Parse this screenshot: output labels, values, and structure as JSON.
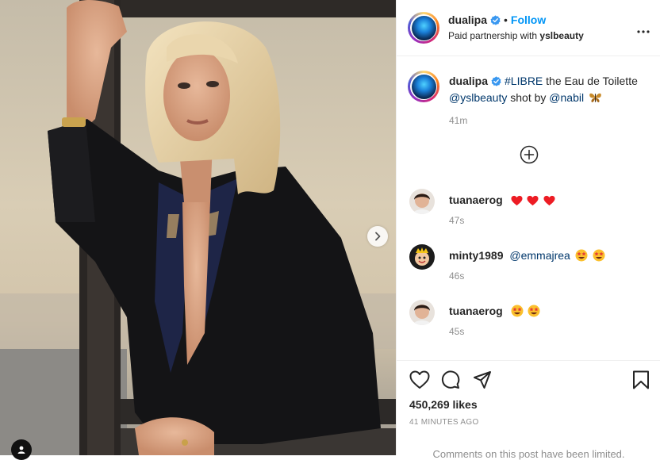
{
  "post": {
    "author": "dualipa",
    "follow_label": "Follow",
    "separator": "•",
    "partnership_prefix": "Paid partnership with",
    "partner": "yslbeauty"
  },
  "caption": {
    "user": "dualipa",
    "hashtag": "#LIBRE",
    "text1": "the Eau de Toilette",
    "mention1": "@yslbeauty",
    "text2": "shot by",
    "mention2": "@nabil",
    "emoji": "butterfly-icon",
    "time": "41m"
  },
  "comments": [
    {
      "user": "tuanaerog",
      "text": "",
      "emojis": [
        "heart-icon",
        "heart-icon",
        "heart-icon"
      ],
      "time": "47s"
    },
    {
      "user": "minty1989",
      "mention": "@emmajrea",
      "emojis": [
        "star-eyes-icon",
        "star-eyes-icon"
      ],
      "time": "46s"
    },
    {
      "user": "tuanaerog",
      "text": "",
      "emojis": [
        "star-eyes-icon",
        "star-eyes-icon"
      ],
      "time": "45s"
    }
  ],
  "actions": {
    "likes": "450,269 likes",
    "time_ago": "41 MINUTES AGO",
    "limited_notice": "Comments on this post have been limited."
  },
  "colors": {
    "link_blue": "#0095f6",
    "mention_navy": "#00376b",
    "muted_gray": "#8e8e8e",
    "heart_red": "#ed4956"
  }
}
